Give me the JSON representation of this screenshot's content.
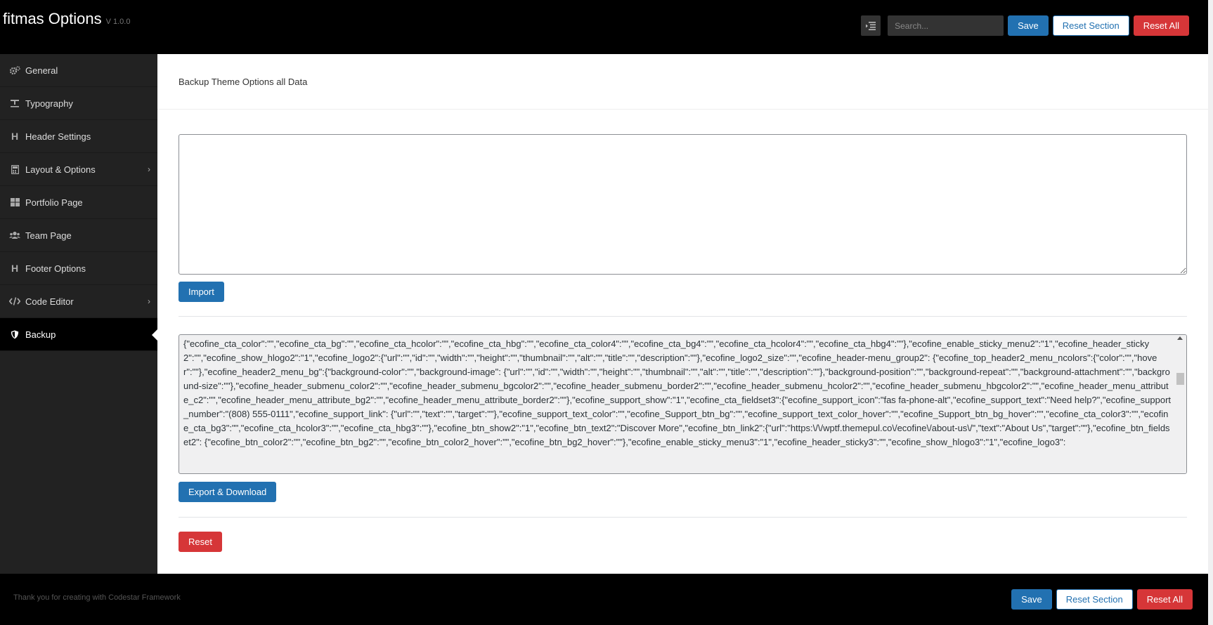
{
  "header": {
    "title": "fitmas Options",
    "version": "V 1.0.0",
    "search_placeholder": "Search...",
    "save_label": "Save",
    "reset_section_label": "Reset Section",
    "reset_all_label": "Reset All"
  },
  "sidebar": {
    "items": [
      {
        "label": "General",
        "icon": "gears-icon"
      },
      {
        "label": "Typography",
        "icon": "text-height-icon"
      },
      {
        "label": "Header Settings",
        "icon": "heading-icon"
      },
      {
        "label": "Layout & Options",
        "icon": "calculator-icon",
        "has_children": true
      },
      {
        "label": "Portfolio Page",
        "icon": "th-large-icon"
      },
      {
        "label": "Team Page",
        "icon": "users-icon"
      },
      {
        "label": "Footer Options",
        "icon": "heading-icon"
      },
      {
        "label": "Code Editor",
        "icon": "code-icon",
        "has_children": true
      },
      {
        "label": "Backup",
        "icon": "shield-icon",
        "active": true
      }
    ]
  },
  "main": {
    "section_title": "Backup Theme Options all Data",
    "import_value": "",
    "import_label": "Import",
    "export_value": "{\"ecofine_cta_color\":\"\",\"ecofine_cta_bg\":\"\",\"ecofine_cta_hcolor\":\"\",\"ecofine_cta_hbg\":\"\",\"ecofine_cta_color4\":\"\",\"ecofine_cta_bg4\":\"\",\"ecofine_cta_hcolor4\":\"\",\"ecofine_cta_hbg4\":\"\"},\"ecofine_enable_sticky_menu2\":\"1\",\"ecofine_header_sticky2\":\"\",\"ecofine_show_hlogo2\":\"1\",\"ecofine_logo2\":{\"url\":\"\",\"id\":\"\",\"width\":\"\",\"height\":\"\",\"thumbnail\":\"\",\"alt\":\"\",\"title\":\"\",\"description\":\"\"},\"ecofine_logo2_size\":\"\",\"ecofine_header-menu_group2\": {\"ecofine_top_header2_menu_ncolors\":{\"color\":\"\",\"hover\":\"\"},\"ecofine_header2_menu_bg\":{\"background-color\":\"\",\"background-image\": {\"url\":\"\",\"id\":\"\",\"width\":\"\",\"height\":\"\",\"thumbnail\":\"\",\"alt\":\"\",\"title\":\"\",\"description\":\"\"},\"background-position\":\"\",\"background-repeat\":\"\",\"background-attachment\":\"\",\"background-size\":\"\"},\"ecofine_header_submenu_color2\":\"\",\"ecofine_header_submenu_bgcolor2\":\"\",\"ecofine_header_submenu_border2\":\"\",\"ecofine_header_submenu_hcolor2\":\"\",\"ecofine_header_submenu_hbgcolor2\":\"\",\"ecofine_header_menu_attribute_c2\":\"\",\"ecofine_header_menu_attribute_bg2\":\"\",\"ecofine_header_menu_attribute_border2\":\"\"},\"ecofine_support_show\":\"1\",\"ecofine_cta_fieldset3\":{\"ecofine_support_icon\":\"fas fa-phone-alt\",\"ecofine_support_text\":\"Need help?\",\"ecofine_support_number\":\"(808) 555-0111\",\"ecofine_support_link\": {\"url\":\"\",\"text\":\"\",\"target\":\"\"},\"ecofine_support_text_color\":\"\",\"ecofine_Support_btn_bg\":\"\",\"ecofine_support_text_color_hover\":\"\",\"ecofine_Support_btn_bg_hover\":\"\",\"ecofine_cta_color3\":\"\",\"ecofine_cta_bg3\":\"\",\"ecofine_cta_hcolor3\":\"\",\"ecofine_cta_hbg3\":\"\"},\"ecofine_btn_show2\":\"1\",\"ecofine_btn_text2\":\"Discover More\",\"ecofine_btn_link2\":{\"url\":\"https:\\/\\/wptf.themepul.co\\/ecofine\\/about-us\\/\",\"text\":\"About Us\",\"target\":\"\"},\"ecofine_btn_fieldset2\": {\"ecofine_btn_color2\":\"\",\"ecofine_btn_bg2\":\"\",\"ecofine_btn_color2_hover\":\"\",\"ecofine_btn_bg2_hover\":\"\"},\"ecofine_enable_sticky_menu3\":\"1\",\"ecofine_header_sticky3\":\"\",\"ecofine_show_hlogo3\":\"1\",\"ecofine_logo3\":",
    "export_label": "Export & Download",
    "reset_label": "Reset"
  },
  "footer": {
    "text": "Thank you for creating with Codestar Framework",
    "save_label": "Save",
    "reset_section_label": "Reset Section",
    "reset_all_label": "Reset All"
  },
  "colors": {
    "primary": "#2271b1",
    "danger": "#d63638",
    "sidebar_bg": "#222222",
    "header_bg": "#000000"
  }
}
